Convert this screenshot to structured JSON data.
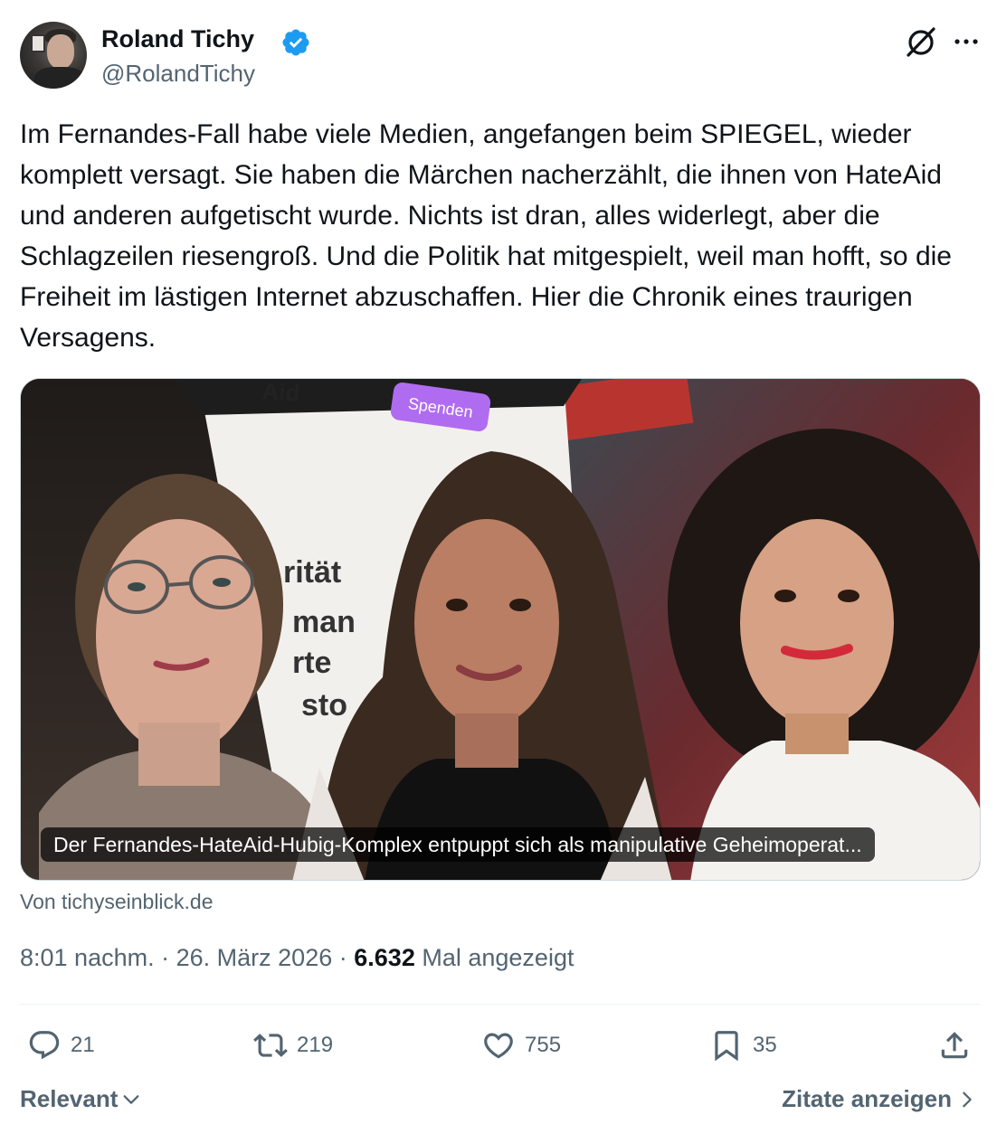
{
  "author": {
    "name": "Roland Tichy",
    "handle": "@RolandTichy",
    "verified": true
  },
  "icons": {
    "verified": "verified-badge-icon",
    "grok": "grok-icon",
    "more": "more-options-icon",
    "reply": "reply-icon",
    "retweet": "retweet-icon",
    "like": "heart-icon",
    "bookmark": "bookmark-icon",
    "share": "share-icon"
  },
  "tweet": {
    "text": "Im Fernandes-Fall habe viele Medien, angefangen beim SPIEGEL, wieder komplett versagt. Sie haben die Märchen nacherzählt, die ihnen von HateAid und anderen aufgetischt wurde. Nichts ist dran, alles widerlegt, aber die Schlagzeilen riesengroß. Und die Politik hat mitgespielt, weil man hofft, so die Freiheit im lästigen Internet abzuschaffen. Hier die Chronik eines traurigen Versagens."
  },
  "card": {
    "image_text_top": "Aid",
    "image_button": "Spenden",
    "image_fragments": [
      "rität",
      "man",
      "rte",
      "sto"
    ],
    "caption": "Der Fernandes-HateAid-Hubig-Komplex entpuppt sich als manipulative Geheimoperat...",
    "source": "Von tichyseinblick.de"
  },
  "meta": {
    "time": "8:01 nachm.",
    "separator": "·",
    "date": "26. März 2026",
    "views_count": "6.632",
    "views_label": "Mal angezeigt"
  },
  "actions": {
    "replies": "21",
    "retweets": "219",
    "likes": "755",
    "bookmarks": "35"
  },
  "footer": {
    "sort_label": "Relevant",
    "quotes_label": "Zitate anzeigen"
  },
  "colors": {
    "text": "#0f1419",
    "secondary": "#536471",
    "verified": "#1d9bf0",
    "divider": "#eff3f4",
    "button_purple": "#b06cf0"
  }
}
